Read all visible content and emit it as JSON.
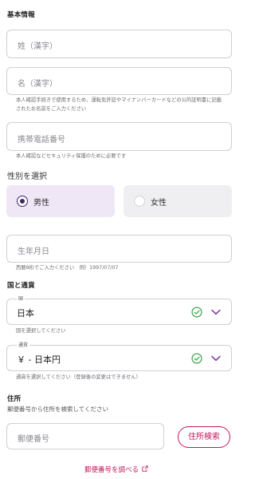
{
  "basic_info": {
    "title": "基本情報",
    "last_name_placeholder": "姓（漢字）",
    "first_name_placeholder": "名（漢字）",
    "name_help": "本人確認手続きで使用するため、運転免許証やマイナンバーカードなどの公的証明書に記載されたお名前をご入力ください",
    "phone_placeholder": "携帯電話番号",
    "phone_help": "本人確認などセキュリティ保護のために必要です"
  },
  "gender": {
    "title": "性別を選択",
    "options": [
      {
        "label": "男性",
        "selected": true
      },
      {
        "label": "女性",
        "selected": false
      }
    ]
  },
  "birthdate": {
    "placeholder": "生年月日",
    "help": "西暦8桁でご入力ください　例）1997/07/07"
  },
  "country_currency": {
    "title": "国と通貨",
    "country": {
      "legend": "国",
      "value": "日本",
      "help": "国を選択してください"
    },
    "currency": {
      "legend": "通貨",
      "value": "￥ - 日本円",
      "help": "通貨を選択してください（登録後の変更はできません）"
    }
  },
  "address": {
    "title": "住所",
    "subtitle": "郵便番号から住所を検索してください",
    "postal_placeholder": "郵便番号",
    "search_button": "住所検索",
    "lookup_link": "郵便番号を調べる"
  },
  "colors": {
    "accent": "#c2185b",
    "radio_selected": "#3b2a63",
    "selected_bg": "#efe7f6",
    "unselected_bg": "#efeff1",
    "check_green": "#2e9d3a",
    "chevron_purple": "#7b2f9e"
  },
  "icons": {
    "valid": "check-circle-icon",
    "dropdown": "chevron-down-icon",
    "external": "external-link-icon"
  }
}
